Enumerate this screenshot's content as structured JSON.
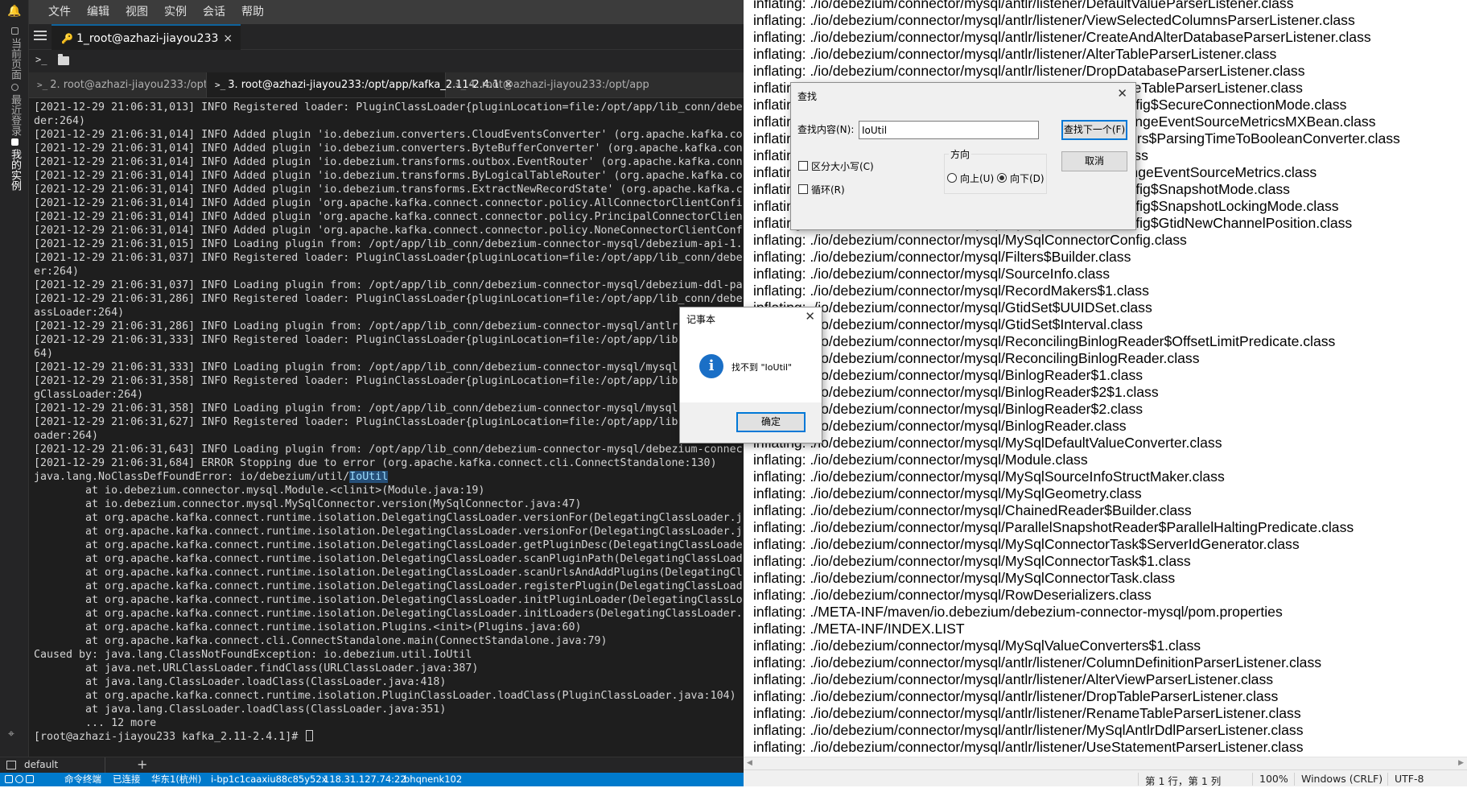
{
  "terminal_app": {
    "sidebar_tabs": [
      "当前页面",
      "最近登录",
      "我的实例"
    ],
    "menu": [
      "文件",
      "编辑",
      "视图",
      "实例",
      "会话",
      "帮助"
    ],
    "session_tab": {
      "label": "1_root@azhazi-jiayou233",
      "close": "×"
    },
    "tabs": [
      {
        "label": "2. root@azhazi-jiayou233:/opt/app",
        "active": false
      },
      {
        "label": "3. root@azhazi-jiayou233:/opt/app/kafka_2.11-2.4.1",
        "active": true
      },
      {
        "label": "4. root@azhazi-jiayou233:/opt/app",
        "active": false
      }
    ],
    "terminal_lines": [
      "[2021-12-29 21:06:31,013] INFO Registered loader: PluginClassLoader{pluginLocation=file:/opt/app/lib_conn/debe",
      "der:264)",
      "[2021-12-29 21:06:31,014] INFO Added plugin 'io.debezium.converters.CloudEventsConverter' (org.apache.kafka.co",
      "[2021-12-29 21:06:31,014] INFO Added plugin 'io.debezium.converters.ByteBufferConverter' (org.apache.kafka.con",
      "[2021-12-29 21:06:31,014] INFO Added plugin 'io.debezium.transforms.outbox.EventRouter' (org.apache.kafka.conn",
      "[2021-12-29 21:06:31,014] INFO Added plugin 'io.debezium.transforms.ByLogicalTableRouter' (org.apache.kafka.co",
      "[2021-12-29 21:06:31,014] INFO Added plugin 'io.debezium.transforms.ExtractNewRecordState' (org.apache.kafka.c",
      "[2021-12-29 21:06:31,014] INFO Added plugin 'org.apache.kafka.connect.connector.policy.AllConnectorClientConfi",
      "[2021-12-29 21:06:31,014] INFO Added plugin 'org.apache.kafka.connect.connector.policy.PrincipalConnectorClien",
      "[2021-12-29 21:06:31,014] INFO Added plugin 'org.apache.kafka.connect.connector.policy.NoneConnectorClientConf",
      "[2021-12-29 21:06:31,015] INFO Loading plugin from: /opt/app/lib_conn/debezium-connector-mysql/debezium-api-1.",
      "[2021-12-29 21:06:31,037] INFO Registered loader: PluginClassLoader{pluginLocation=file:/opt/app/lib_conn/debe",
      "er:264)",
      "[2021-12-29 21:06:31,037] INFO Loading plugin from: /opt/app/lib_conn/debezium-connector-mysql/debezium-ddl-pa",
      "[2021-12-29 21:06:31,286] INFO Registered loader: PluginClassLoader{pluginLocation=file:/opt/app/lib_conn/debe",
      "assLoader:264)",
      "[2021-12-29 21:06:31,286] INFO Loading plugin from: /opt/app/lib_conn/debezium-connector-mysql/antlr",
      "[2021-12-29 21:06:31,333] INFO Registered loader: PluginClassLoader{pluginLocation=file:/opt/app/lib",
      "64)",
      "[2021-12-29 21:06:31,333] INFO Loading plugin from: /opt/app/lib_conn/debezium-connector-mysql/mysql",
      "[2021-12-29 21:06:31,358] INFO Registered loader: PluginClassLoader{pluginLocation=file:/opt/app/lib",
      "gClassLoader:264)",
      "[2021-12-29 21:06:31,358] INFO Loading plugin from: /opt/app/lib_conn/debezium-connector-mysql/mysql",
      "[2021-12-29 21:06:31,627] INFO Registered loader: PluginClassLoader{pluginLocation=file:/opt/app/lib",
      "oader:264)",
      "[2021-12-29 21:06:31,643] INFO Loading plugin from: /opt/app/lib_conn/debezium-connector-mysql/debezium-connec",
      "[2021-12-29 21:06:31,684] ERROR Stopping due to error (org.apache.kafka.connect.cli.ConnectStandalone:130)",
      "java.lang.NoClassDefFoundError: io/debezium/util/",
      "        at io.debezium.connector.mysql.Module.<clinit>(Module.java:19)",
      "        at io.debezium.connector.mysql.MySqlConnector.version(MySqlConnector.java:47)",
      "        at org.apache.kafka.connect.runtime.isolation.DelegatingClassLoader.versionFor(DelegatingClassLoader.j",
      "        at org.apache.kafka.connect.runtime.isolation.DelegatingClassLoader.versionFor(DelegatingClassLoader.j",
      "        at org.apache.kafka.connect.runtime.isolation.DelegatingClassLoader.getPluginDesc(DelegatingClassLoade",
      "        at org.apache.kafka.connect.runtime.isolation.DelegatingClassLoader.scanPluginPath(DelegatingClassLoad",
      "        at org.apache.kafka.connect.runtime.isolation.DelegatingClassLoader.scanUrlsAndAddPlugins(DelegatingCl",
      "        at org.apache.kafka.connect.runtime.isolation.DelegatingClassLoader.registerPlugin(DelegatingClassLoad",
      "        at org.apache.kafka.connect.runtime.isolation.DelegatingClassLoader.initPluginLoader(DelegatingClassLo",
      "        at org.apache.kafka.connect.runtime.isolation.DelegatingClassLoader.initLoaders(DelegatingClassLoader.",
      "        at org.apache.kafka.connect.runtime.isolation.Plugins.<init>(Plugins.java:60)",
      "        at org.apache.kafka.connect.cli.ConnectStandalone.main(ConnectStandalone.java:79)",
      "Caused by: java.lang.ClassNotFoundException: io.debezium.util.IoUtil",
      "        at java.net.URLClassLoader.findClass(URLClassLoader.java:387)",
      "        at java.lang.ClassLoader.loadClass(ClassLoader.java:418)",
      "        at org.apache.kafka.connect.runtime.isolation.PluginClassLoader.loadClass(PluginClassLoader.java:104)",
      "        at java.lang.ClassLoader.loadClass(ClassLoader.java:351)",
      "        ... 12 more",
      "[root@azhazi-jiayou233 kafka_2.11-2.4.1]# "
    ],
    "highlight_word": "IoUtil",
    "workspace_label": "default",
    "workspace_add": "+",
    "status": {
      "mode": "命令终端",
      "connection": "已连接",
      "region": "华东1(杭州)",
      "instance_id": "i-bp1c1caaxiu88c85y52x",
      "ip": "118.31.127.74:22",
      "host": "bhqnenk102"
    }
  },
  "notepad": {
    "lines": [
      "inflating: ./io/debezium/connector/mysql/antlr/listener/DefaultValueParserListener.class",
      "inflating: ./io/debezium/connector/mysql/antlr/listener/ViewSelectedColumnsParserListener.class",
      "inflating: ./io/debezium/connector/mysql/antlr/listener/CreateAndAlterDatabaseParserListener.class",
      "inflating: ./io/debezium/connector/mysql/antlr/listener/AlterTableParserListener.class",
      "inflating: ./io/debezium/connector/mysql/antlr/listener/DropDatabaseParserListener.class",
      "inflating: ./io/debezium/connector/mysql/antlr/listener/TruncateTableParserListener.class",
      "inflating: ./io/debezium/connector/mysql/MySqlConnectorConfig$SecureConnectionMode.class",
      "inflating: ./io/debezium/connector/mysql/MySqlStreamingChangeEventSourceMetricsMXBean.class",
      "inflating: ./io/debezium/connector/mysql/MySqlValueConverters$ParsingTimeToBooleanConverter.class",
      "inflating: ./io/debezium/connector/mysql/MySqlSchema$1.class",
      "inflating: ./io/debezium/connector/mysql/MySqlSnapshotChangeEventSourceMetrics.class",
      "inflating: ./io/debezium/connector/mysql/MySqlConnectorConfig$SnapshotMode.class",
      "inflating: ./io/debezium/connector/mysql/MySqlConnectorConfig$SnapshotLockingMode.class",
      "inflating: ./io/debezium/connector/mysql/MySqlConnectorConfig$GtidNewChannelPosition.class",
      "inflating: ./io/debezium/connector/mysql/MySqlConnectorConfig.class",
      "inflating: ./io/debezium/connector/mysql/Filters$Builder.class",
      "inflating: ./io/debezium/connector/mysql/SourceInfo.class",
      "inflating: ./io/debezium/connector/mysql/RecordMakers$1.class",
      "inflating: ./io/debezium/connector/mysql/GtidSet$UUIDSet.class",
      "inflating: ./io/debezium/connector/mysql/GtidSet$Interval.class",
      "inflating: ./io/debezium/connector/mysql/ReconcilingBinlogReader$OffsetLimitPredicate.class",
      "inflating: ./io/debezium/connector/mysql/ReconcilingBinlogReader.class",
      "inflating: ./io/debezium/connector/mysql/BinlogReader$1.class",
      "inflating: ./io/debezium/connector/mysql/BinlogReader$2$1.class",
      "inflating: ./io/debezium/connector/mysql/BinlogReader$2.class",
      "inflating: ./io/debezium/connector/mysql/BinlogReader.class",
      "inflating: ./io/debezium/connector/mysql/MySqlDefaultValueConverter.class",
      "inflating: ./io/debezium/connector/mysql/Module.class",
      "inflating: ./io/debezium/connector/mysql/MySqlSourceInfoStructMaker.class",
      "inflating: ./io/debezium/connector/mysql/MySqlGeometry.class",
      "inflating: ./io/debezium/connector/mysql/ChainedReader$Builder.class",
      "inflating: ./io/debezium/connector/mysql/ParallelSnapshotReader$ParallelHaltingPredicate.class",
      "inflating: ./io/debezium/connector/mysql/MySqlConnectorTask$ServerIdGenerator.class",
      "inflating: ./io/debezium/connector/mysql/MySqlConnectorTask$1.class",
      "inflating: ./io/debezium/connector/mysql/MySqlConnectorTask.class",
      "inflating: ./io/debezium/connector/mysql/RowDeserializers.class",
      "inflating: ./META-INF/maven/io.debezium/debezium-connector-mysql/pom.properties",
      "inflating: ./META-INF/INDEX.LIST",
      "inflating: ./io/debezium/connector/mysql/MySqlValueConverters$1.class",
      "inflating: ./io/debezium/connector/mysql/antlr/listener/ColumnDefinitionParserListener.class",
      "inflating: ./io/debezium/connector/mysql/antlr/listener/AlterViewParserListener.class",
      "inflating: ./io/debezium/connector/mysql/antlr/listener/DropTableParserListener.class",
      "inflating: ./io/debezium/connector/mysql/antlr/listener/RenameTableParserListener.class",
      "inflating: ./io/debezium/connector/mysql/antlr/listener/MySqlAntlrDdlParserListener.class",
      "inflating: ./io/debezium/connector/mysql/antlr/listener/UseStatementParserListener.class"
    ],
    "status": {
      "position": "第 1 行，第 1 列",
      "zoom": "100%",
      "line_ending": "Windows (CRLF)",
      "encoding": "UTF-8"
    }
  },
  "find_dialog": {
    "title": "查找",
    "find_label": "查找内容(N):",
    "find_value": "IoUtil",
    "find_next": "查找下一个(F)",
    "cancel": "取消",
    "direction_label": "方向",
    "up": "向上(U)",
    "down": "向下(D)",
    "match_case": "区分大小写(C)",
    "wrap": "循环(R)"
  },
  "message_box": {
    "title": "记事本",
    "text": "找不到 \"IoUtil\"",
    "ok": "确定"
  }
}
